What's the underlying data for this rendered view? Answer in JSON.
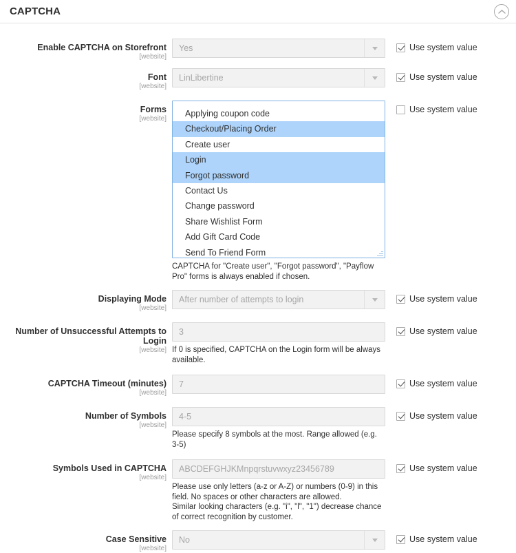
{
  "header": {
    "title": "CAPTCHA",
    "collapse_icon": "chevron-up-circle-icon"
  },
  "common": {
    "scope": "[website]",
    "use_system_value": "Use system value"
  },
  "fields": {
    "enable": {
      "label": "Enable CAPTCHA on Storefront",
      "scope": "[website]",
      "value": "Yes",
      "type": "select",
      "use_system_value": true
    },
    "font": {
      "label": "Font",
      "scope": "[website]",
      "value": "LinLibertine",
      "type": "select",
      "use_system_value": true
    },
    "forms": {
      "label": "Forms",
      "scope": "[website]",
      "type": "multiselect",
      "use_system_value": false,
      "options": [
        {
          "label": "Applying coupon code",
          "selected": false
        },
        {
          "label": "Checkout/Placing Order",
          "selected": true
        },
        {
          "label": "Create user",
          "selected": false
        },
        {
          "label": "Login",
          "selected": true
        },
        {
          "label": "Forgot password",
          "selected": true
        },
        {
          "label": "Contact Us",
          "selected": false
        },
        {
          "label": "Change password",
          "selected": false
        },
        {
          "label": "Share Wishlist Form",
          "selected": false
        },
        {
          "label": "Add Gift Card Code",
          "selected": false
        },
        {
          "label": "Send To Friend Form",
          "selected": false
        }
      ],
      "note": "CAPTCHA for \"Create user\", \"Forgot password\", \"Payflow Pro\" forms is always enabled if chosen."
    },
    "displaying_mode": {
      "label": "Displaying Mode",
      "scope": "[website]",
      "value": "After number of attempts to login",
      "type": "select",
      "use_system_value": true
    },
    "attempts": {
      "label": "Number of Unsuccessful Attempts to Login",
      "scope": "[website]",
      "value": "3",
      "type": "text",
      "use_system_value": true,
      "note": "If 0 is specified, CAPTCHA on the Login form will be always available."
    },
    "timeout": {
      "label": "CAPTCHA Timeout (minutes)",
      "scope": "[website]",
      "value": "7",
      "type": "text",
      "use_system_value": true
    },
    "symbol_count": {
      "label": "Number of Symbols",
      "scope": "[website]",
      "value": "4-5",
      "type": "text",
      "use_system_value": true,
      "note": "Please specify 8 symbols at the most. Range allowed (e.g. 3-5)"
    },
    "symbols": {
      "label": "Symbols Used in CAPTCHA",
      "scope": "[website]",
      "value": "ABCDEFGHJKMnpqrstuvwxyz23456789",
      "type": "text",
      "use_system_value": true,
      "note": "Please use only letters (a-z or A-Z) or numbers (0-9) in this field. No spaces or other characters are allowed.\nSimilar looking characters (e.g. \"i\", \"l\", \"1\") decrease chance of correct recognition by customer."
    },
    "case_sensitive": {
      "label": "Case Sensitive",
      "scope": "[website]",
      "value": "No",
      "type": "select",
      "use_system_value": true
    }
  },
  "colors": {
    "selection_highlight": "#aed4fb",
    "field_background": "#f2f2f2",
    "multiselect_border": "#7fb2e0"
  }
}
